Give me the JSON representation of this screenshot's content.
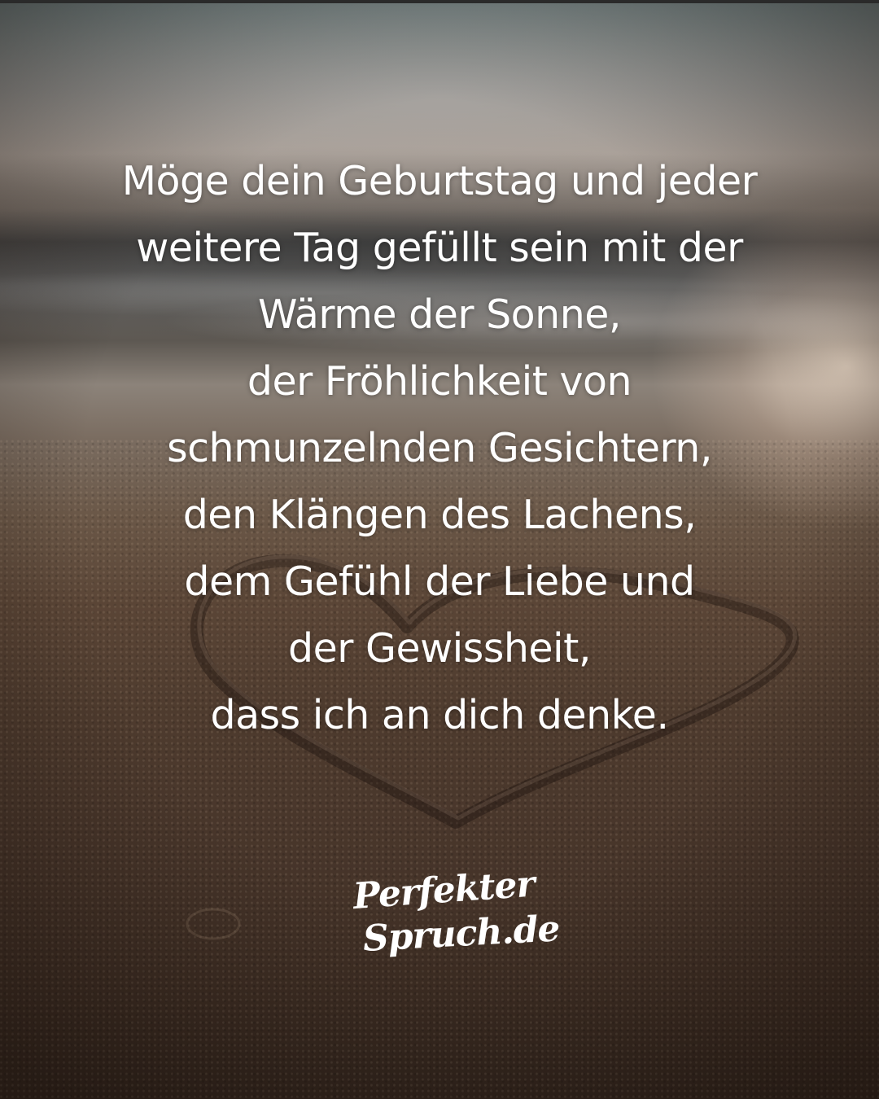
{
  "quote": {
    "lines": [
      "Möge dein Geburtstag und jeder",
      "weitere Tag gefüllt sein mit der",
      "Wärme der Sonne,",
      "der Fröhlichkeit von",
      "schmunzelnden Gesichtern,",
      "den Klängen des Lachens,",
      "dem Gefühl der Liebe und",
      "der Gewissheit,",
      "dass ich an dich denke."
    ]
  },
  "logo": {
    "line1": "Perfekter",
    "line2": "Spruch.de"
  },
  "colors": {
    "text": "#ffffff",
    "sand": "#4e3b2e",
    "sky": "#8a8c8a",
    "sun_glow": "#ffebd7"
  }
}
